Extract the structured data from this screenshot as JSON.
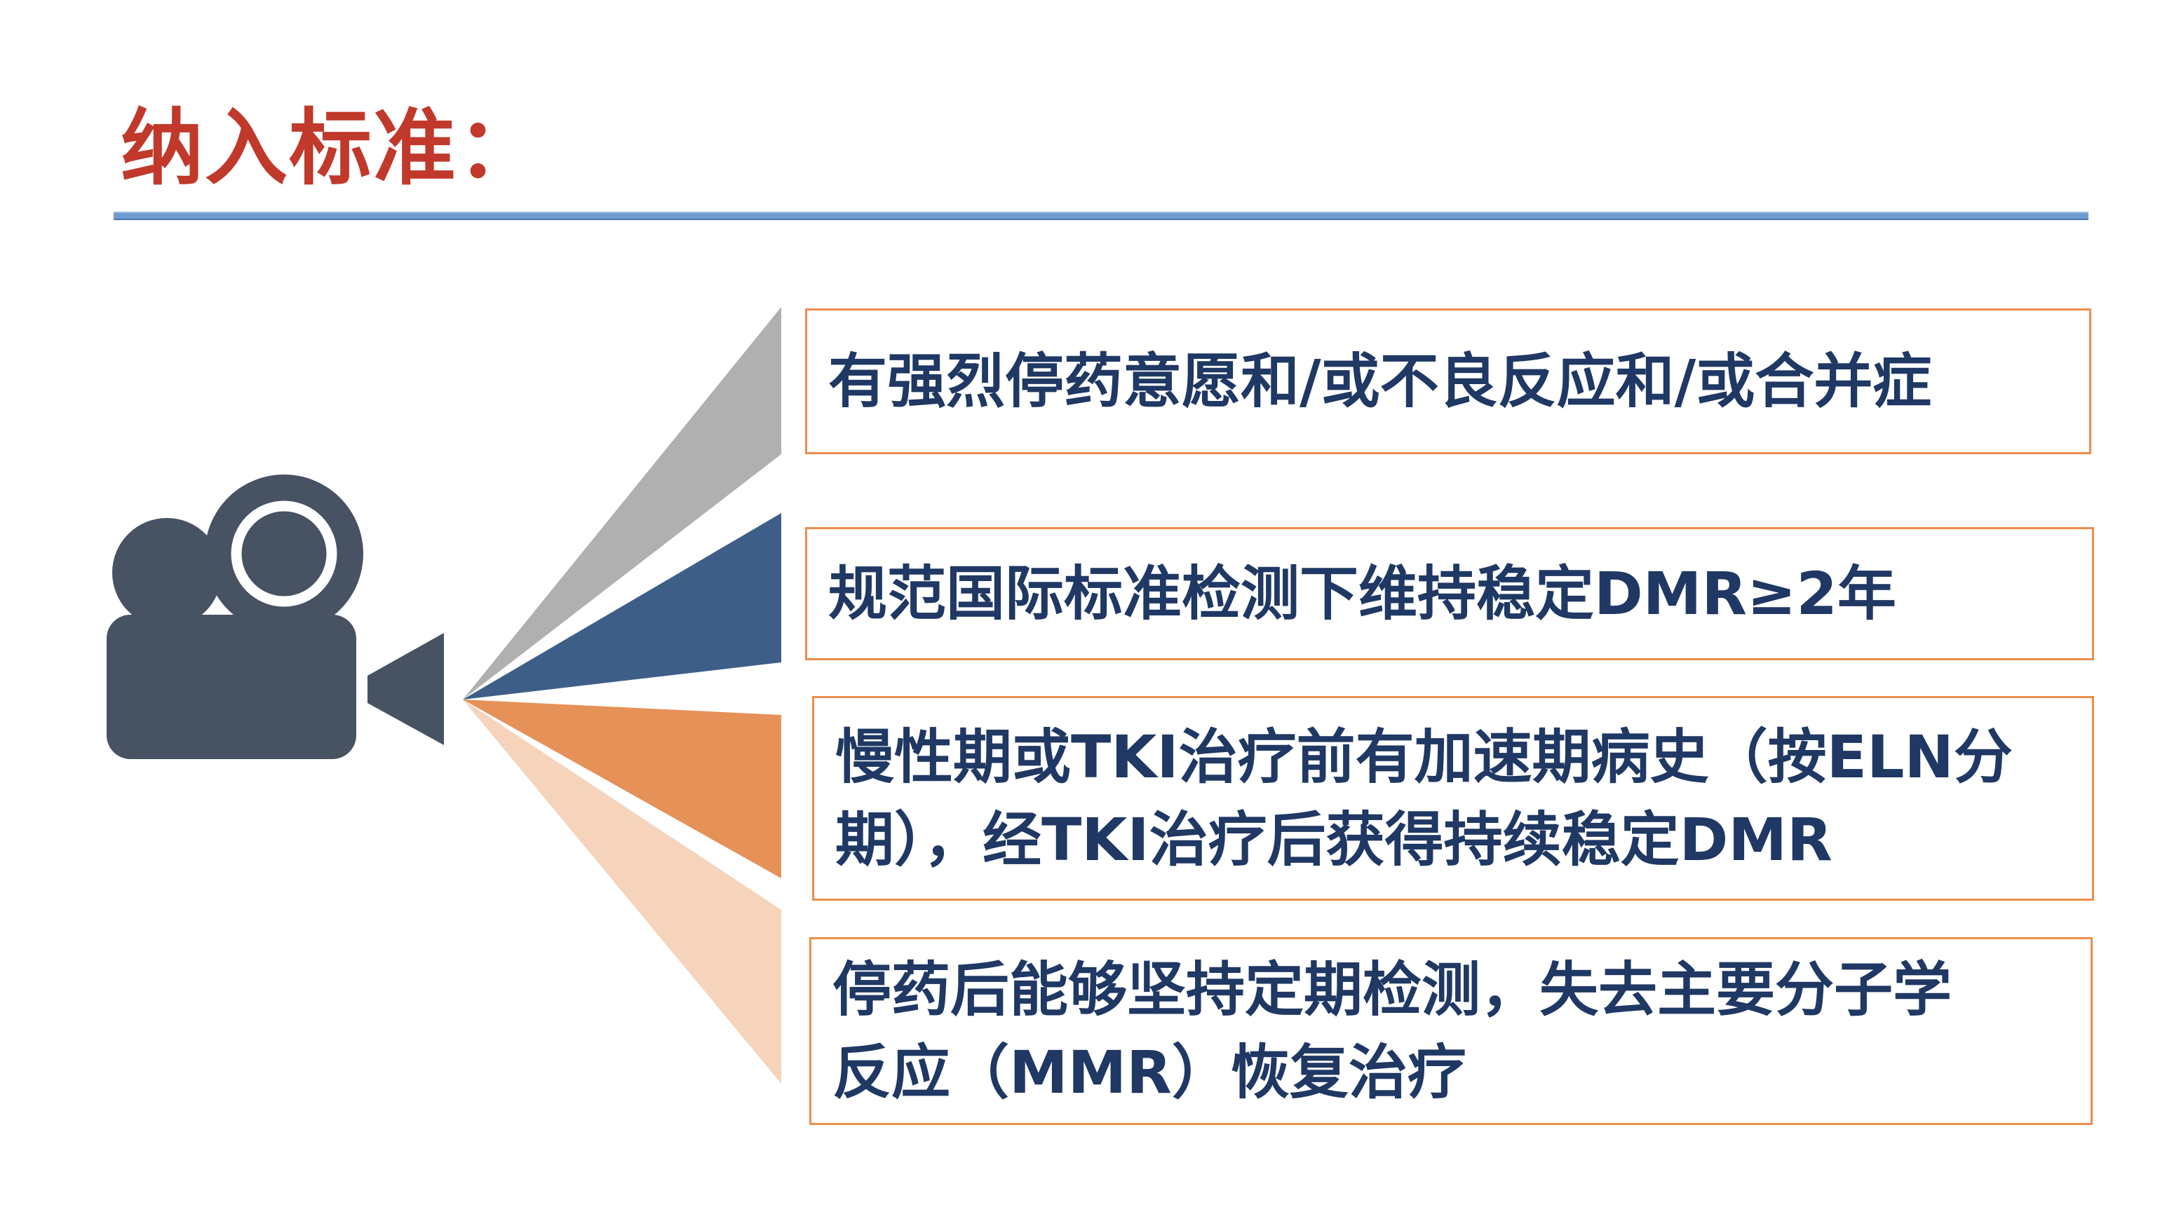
{
  "title": "纳入标准：",
  "colors": {
    "title": "#c0392b",
    "rule": "#6f9bd0",
    "camera": "#475263",
    "box_border": "#ed8d4c",
    "text": "#1f3864",
    "ray_gray": "#b0b0b0",
    "ray_blue": "#3d5f87",
    "ray_orange": "#e69158",
    "ray_peach": "#f6d3bb"
  },
  "icon": "video-camera-icon",
  "criteria": [
    {
      "text": "有强烈停药意愿和/或不良反应和/或合并症"
    },
    {
      "text": "规范国际标准检测下维持稳定DMR≥2年"
    },
    {
      "text": "慢性期或TKI治疗前有加速期病史（按ELN分\n期），经TKI治疗后获得持续稳定DMR"
    },
    {
      "text": "停药后能够坚持定期检测，失去主要分子学\n反应（MMR）恢复治疗"
    }
  ]
}
